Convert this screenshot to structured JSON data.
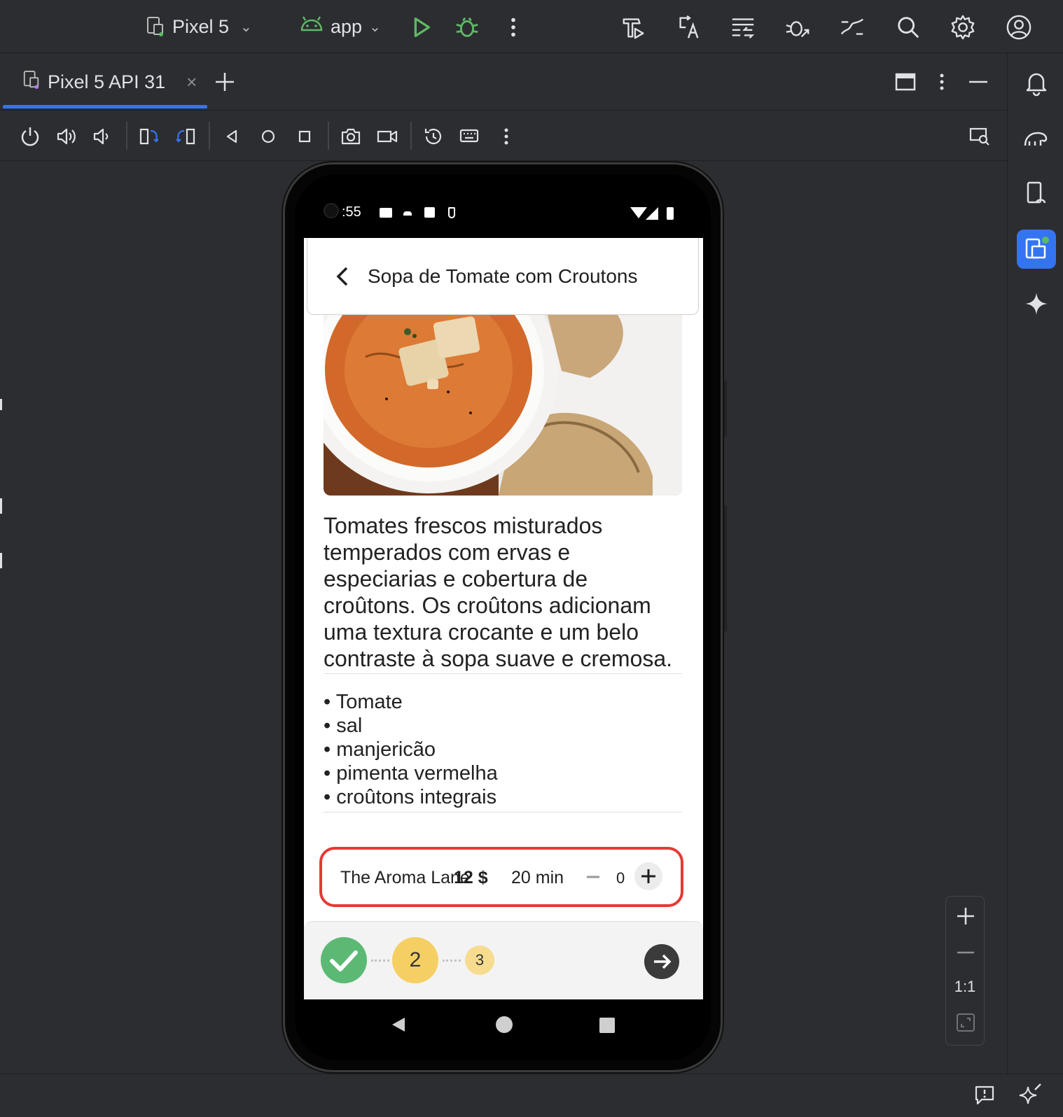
{
  "toolbar": {
    "device_label": "Pixel 5",
    "run_config_label": "app"
  },
  "tab": {
    "label": "Pixel 5 API 31"
  },
  "phone": {
    "status_time": ":55",
    "app_title": "Sopa de Tomate com Croutons",
    "description": "Tomates frescos misturados temperados com ervas e especiarias e cobertura de croûtons. Os croûtons adicionam uma textura crocante e um belo contraste à sopa suave e cremosa.",
    "ingredients": [
      "Tomate",
      "sal",
      "manjericão",
      "pimenta vermelha",
      "croûtons integrais"
    ],
    "order": {
      "restaurant": "The Aroma Lane",
      "price": "12 $",
      "time": "20 min",
      "quantity": "0"
    },
    "steps": {
      "step2": "2",
      "step3": "3"
    }
  },
  "zoom": {
    "ratio_label": "1:1"
  },
  "colors": {
    "accent": "#3574f0",
    "run_green": "#5fb865",
    "highlight_red": "#e53935",
    "step_yellow": "#f5cf63",
    "step_done_green": "#5bb974"
  }
}
